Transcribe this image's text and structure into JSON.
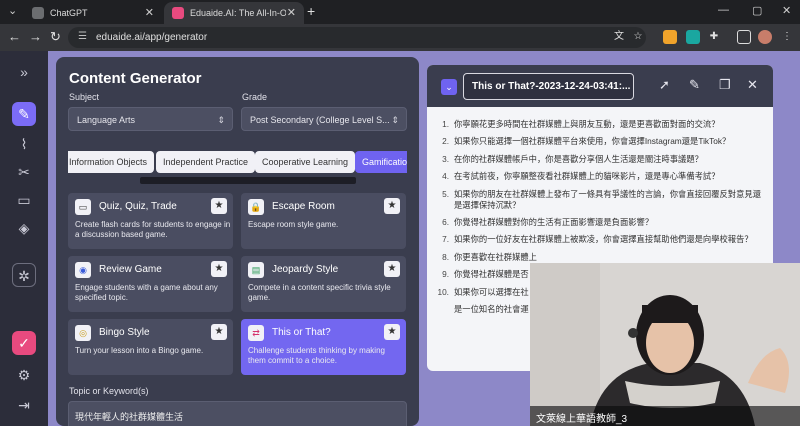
{
  "browser": {
    "tabs": [
      {
        "title": "ChatGPT"
      },
      {
        "title": "Eduaide.AI: The All-In-One AI Te"
      }
    ],
    "url": "eduaide.ai/app/generator"
  },
  "generator": {
    "title": "Content Generator",
    "subject_label": "Subject",
    "subject_value": "Language Arts",
    "grade_label": "Grade",
    "grade_value": "Post Secondary (College Level S...",
    "categories": [
      "Information Objects",
      "Independent Practice",
      "Cooperative Learning",
      "Gamificatio"
    ],
    "active_category": "Gamificatio",
    "cards": [
      {
        "title": "Quiz, Quiz, Trade",
        "desc": "Create flash cards for students to engage in a discussion based game.",
        "icon": "card-icon"
      },
      {
        "title": "Escape Room",
        "desc": "Escape room style game.",
        "icon": "lock-icon"
      },
      {
        "title": "Review Game",
        "desc": "Engage students with a game about any specified topic.",
        "icon": "target-icon"
      },
      {
        "title": "Jeopardy Style",
        "desc": "Compete in a content specific trivia style game.",
        "icon": "board-icon"
      },
      {
        "title": "Bingo Style",
        "desc": "Turn your lesson into a Bingo game.",
        "icon": "bingo-icon"
      },
      {
        "title": "This or That?",
        "desc": "Challenge students thinking by making them commit to a choice.",
        "icon": "swap-icon"
      }
    ],
    "topic_label": "Topic or Keyword(s)",
    "topic_value": "現代年輕人的社群媒體生活"
  },
  "output": {
    "title": "This or That?-2023-12-24-03:41:...",
    "questions": [
      "你寧願花更多時間在社群媒體上與朋友互動，還是更喜歡面對面的交流？",
      "如果你只能選擇一個社群媒體平台來使用，你會選擇Instagram還是TikTok？",
      "在你的社群媒體帳戶中，你是喜歡分享個人生活還是關注時事議題？",
      "在考試前夜，你寧願整夜看社群媒體上的貓咪影片，還是專心準備考試？",
      "如果你的朋友在社群媒體上發布了一條具有爭議性的言論，你會直接回覆反對意見還是選擇保持沉默？",
      "你覺得社群媒體對你的生活有正面影響還是負面影響？",
      "如果你的一位好友在社群媒體上被欺凌，你會選擇直接幫助他們還是向學校報告？",
      "你更喜歡在社群媒體上",
      "你覺得社群媒體是否",
      "如果你可以選擇在社",
      "是一位知名的社會運"
    ]
  },
  "video": {
    "caption": "文萊線上華語教師_3"
  }
}
